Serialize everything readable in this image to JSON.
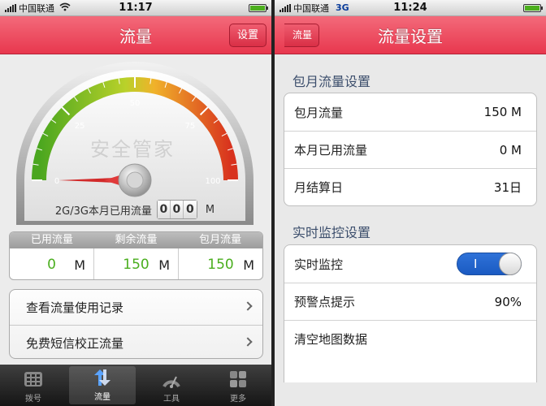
{
  "left": {
    "status": {
      "carrier": "中国联通",
      "network": "",
      "time": "11:17",
      "wifi_icon": "wifi-icon"
    },
    "nav": {
      "title": "流量",
      "right_button": "设置"
    },
    "gauge": {
      "ticks": [
        "0",
        "25",
        "50",
        "75",
        "100"
      ],
      "watermark": "安全管家",
      "label": "2G/3G本月已用流量",
      "digits": [
        "0",
        "0",
        "0"
      ],
      "unit": "M",
      "needle_value": 0
    },
    "stats": {
      "headers": [
        "已用流量",
        "剩余流量",
        "包月流量"
      ],
      "cells": [
        {
          "value": "0",
          "unit": "M"
        },
        {
          "value": "150",
          "unit": "M"
        },
        {
          "value": "150",
          "unit": "M"
        }
      ]
    },
    "actions": [
      {
        "label": "查看流量使用记录"
      },
      {
        "label": "免费短信校正流量"
      }
    ],
    "tabs": [
      {
        "label": "拨号",
        "icon": "keypad-icon",
        "active": false
      },
      {
        "label": "流量",
        "icon": "traffic-icon",
        "active": true
      },
      {
        "label": "工具",
        "icon": "tools-icon",
        "active": false
      },
      {
        "label": "更多",
        "icon": "more-icon",
        "active": false
      }
    ]
  },
  "right": {
    "status": {
      "carrier": "中国联通",
      "network": "3G",
      "time": "11:24"
    },
    "nav": {
      "title": "流量设置",
      "back_button": "流量"
    },
    "monthly_section": {
      "title": "包月流量设置",
      "rows": [
        {
          "label": "包月流量",
          "value": "150 M"
        },
        {
          "label": "本月已用流量",
          "value": "0 M"
        },
        {
          "label": "月结算日",
          "value": "31日"
        }
      ]
    },
    "monitor_section": {
      "title": "实时监控设置",
      "toggle_row": {
        "label": "实时监控",
        "state_text": "I",
        "on": true
      },
      "rows": [
        {
          "label": "预警点提示",
          "value": "90%"
        },
        {
          "label": "清空地图数据",
          "value": ""
        }
      ]
    }
  },
  "colors": {
    "accent": "#e8374e",
    "value_green": "#4aae1e",
    "toggle_blue": "#1a5ac2"
  }
}
